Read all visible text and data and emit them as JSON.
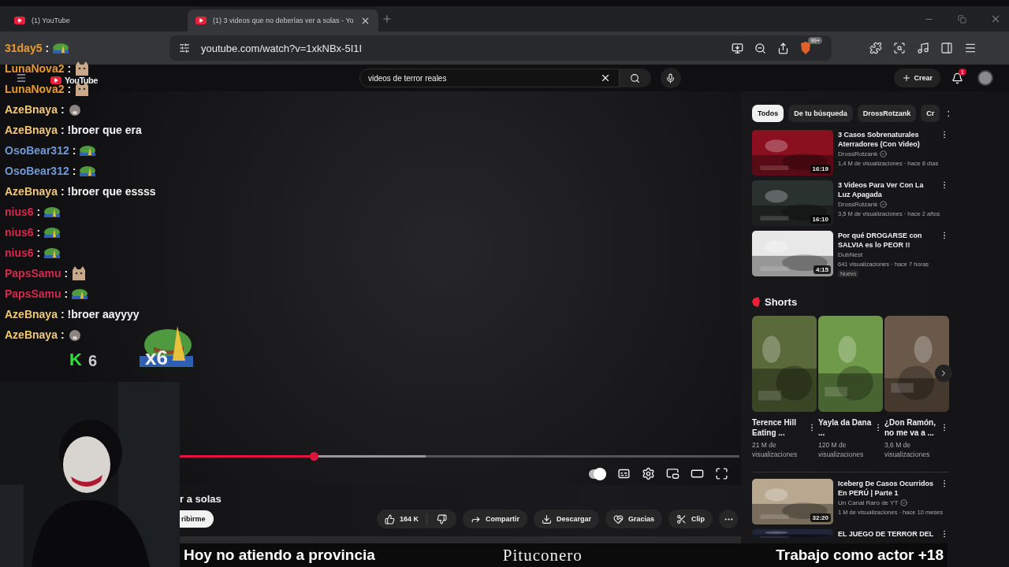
{
  "browser": {
    "tabs": [
      {
        "title": "(1) YouTube",
        "selected": false
      },
      {
        "title": "(1) 3 videos que no deberías ver a solas - Yo",
        "selected": true
      }
    ],
    "address": "youtube.com/watch?v=1xkNBx-5I1I",
    "shields_badge": "99+"
  },
  "masthead": {
    "logo": "YouTube",
    "search_value": "videos de terror reales",
    "create": "Crear",
    "notifications": "1"
  },
  "player": {
    "progress": {
      "level": 0.24
    },
    "buffer": {
      "level": 0.44
    },
    "autoplay": true
  },
  "video": {
    "title": "r a solas",
    "subscribe": "ribirme",
    "likes": "164 K",
    "actions": [
      {
        "kind": "share",
        "label": "Compartir"
      },
      {
        "kind": "download",
        "label": "Descargar"
      },
      {
        "kind": "thanks",
        "label": "Gracias"
      },
      {
        "kind": "clip",
        "label": "Clip"
      }
    ]
  },
  "sidebar": {
    "chips": [
      {
        "label": "Todos",
        "selected": true
      },
      {
        "label": "De tu búsqueda",
        "selected": false
      },
      {
        "label": "DrossRotzank",
        "selected": false
      },
      {
        "label": "Cr",
        "selected": false
      }
    ],
    "videos": [
      {
        "title": "3 Casos Sobrenaturales Aterradores (Con Video)",
        "channel": "DrossRotzank",
        "verified": true,
        "meta": "1,4 M de visualizaciones · hace 8 días",
        "duration": "16:19"
      },
      {
        "title": "3 Videos Para Ver Con La Luz Apagada",
        "channel": "DrossRotzank",
        "verified": true,
        "meta": "3,5 M de visualizaciones · hace 2 años",
        "duration": "16:10"
      },
      {
        "title": "Por qué DROGARSE con SALVIA es lo PEOR !!",
        "channel": "DubNest",
        "verified": false,
        "meta": "641 visualizaciones · hace 7 horas",
        "duration": "4:15",
        "badge": "Nuevo"
      }
    ],
    "shorts": {
      "title": "Shorts",
      "items": [
        {
          "title": "Terence Hill Eating ...",
          "views": "21 M de visualizaciones"
        },
        {
          "title": "Yayla da Dana ...",
          "views": "120 M de visualizaciones"
        },
        {
          "title": "¿Don Ramón, no me va a ...",
          "views": "3,6 M de visualizaciones"
        }
      ]
    },
    "more": [
      {
        "title": "Iceberg De Casos Ocurridos En PERÚ | Parte 1",
        "channel": "Un Canal Raro de YT",
        "verified": true,
        "meta": "1 M de visualizaciones · hace 10 meses",
        "duration": "32:20"
      },
      {
        "title": "EL JUEGO DE TERROR DEL"
      }
    ]
  },
  "chat": [
    {
      "user": "31day5",
      "sep": ":",
      "color": "#e89a2c",
      "kind": "frog"
    },
    {
      "user": "LunaNova2",
      "sep": ":",
      "color": "#e89a2c",
      "kind": "cat"
    },
    {
      "user": "LunaNova2",
      "sep": ":",
      "color": "#e89a2c",
      "kind": "cat"
    },
    {
      "user": "AzeBnaya",
      "sep": ":",
      "color": "#f0c878",
      "kind": "rat"
    },
    {
      "user": "AzeBnaya",
      "sep": ":",
      "color": "#f0c878",
      "kind": "text",
      "message": "!broer que era"
    },
    {
      "user": "OsoBear312",
      "sep": ":",
      "color": "#6f9ad8",
      "kind": "frog"
    },
    {
      "user": "OsoBear312",
      "sep": ":",
      "color": "#6f9ad8",
      "kind": "frog"
    },
    {
      "user": "AzeBnaya",
      "sep": ":",
      "color": "#f0c878",
      "kind": "text",
      "message": "!broer que essss"
    },
    {
      "user": "nius6",
      "sep": ":",
      "color": "#d8284e",
      "kind": "frog"
    },
    {
      "user": "nius6",
      "sep": ":",
      "color": "#d8284e",
      "kind": "frog"
    },
    {
      "user": "nius6",
      "sep": ":",
      "color": "#d8284e",
      "kind": "frog"
    },
    {
      "user": "PapsSamu",
      "sep": ":",
      "color": "#d8284e",
      "kind": "cat"
    },
    {
      "user": "PapsSamu",
      "sep": ":",
      "color": "#d8284e",
      "kind": "frog"
    },
    {
      "user": "AzeBnaya",
      "sep": ":",
      "color": "#f0c878",
      "kind": "text",
      "message": "!broer aayyyy"
    },
    {
      "user": "AzeBnaya",
      "sep": ":",
      "color": "#f0c878",
      "kind": "rat"
    }
  ],
  "combo": {
    "badge": "K",
    "count": "6",
    "multiplier": "x6"
  },
  "captions": [
    "Hoy no atiendo a provincia",
    "Pituconero",
    "Trabajo como actor +18"
  ]
}
